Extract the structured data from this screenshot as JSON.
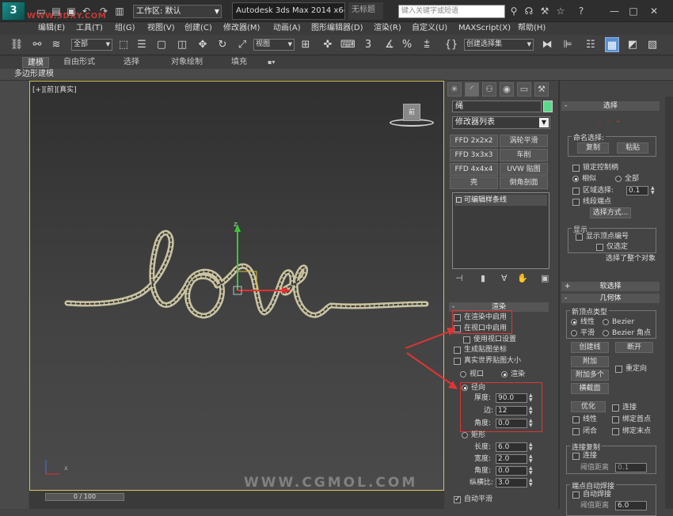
{
  "title_bar": {
    "logo": "3",
    "watermark": "WWW.3DXY.COM",
    "workspace": "工作区: 默认",
    "app_title": "Autodesk 3ds Max  2014 x64",
    "untitled": "无标题",
    "search_placeholder": "键入关键字或短语"
  },
  "menu": [
    "编辑(E)",
    "工具(T)",
    "组(G)",
    "视图(V)",
    "创建(C)",
    "修改器(M)",
    "动画(A)",
    "图形编辑器(D)",
    "渲染(R)",
    "自定义(U)",
    "MAXScript(X)",
    "帮助(H)"
  ],
  "toolbar": {
    "filter": "全部",
    "coord": "视图",
    "selset": "创建选择集",
    "snap": "3",
    "angle": "%"
  },
  "ribbon": {
    "tabs": [
      "建模",
      "自由形式",
      "选择",
      "对象绘制",
      "填充"
    ],
    "active_tab": "建模",
    "subtitle": "多边形建模"
  },
  "viewport": {
    "label": "[+][前][真实]",
    "viewcube": "前",
    "watermark": "WWW.CGMOL.COM",
    "timeline": "0 / 100",
    "gizmo_x": "x",
    "gizmo_z": "z"
  },
  "command_panel": {
    "object_name": "绳",
    "object_color": "#5cd88a",
    "modifier_list": "修改器列表",
    "buttons": [
      "FFD 2x2x2",
      "涡轮平滑",
      "FFD 3x3x3",
      "车削",
      "FFD 4x4x4",
      "UVW 贴图",
      "壳",
      "倒角剖面"
    ],
    "stack_item": "可编辑样条线",
    "rendering": {
      "header": "渲染",
      "enable_render": "在渲染中启用",
      "enable_viewport": "在视口中启用",
      "use_viewport_settings": "使用视口设置",
      "gen_mapping": "生成贴图坐标",
      "real_world": "真实世界贴图大小",
      "viewport": "视口",
      "renderer": "渲染",
      "radial": "径向",
      "thickness_label": "厚度:",
      "thickness": "90.0",
      "sides_label": "边:",
      "sides": "12",
      "angle_label": "角度:",
      "angle": "0.0",
      "rectangular": "矩形",
      "length_label": "长度:",
      "length": "6.0",
      "width_label": "宽度:",
      "width": "2.0",
      "angle2_label": "角度:",
      "angle2": "0.0",
      "aspect_label": "纵横比:",
      "aspect": "3.0",
      "auto_smooth": "自动平滑"
    }
  },
  "right_panel": {
    "selection_header": "选择",
    "named_selection": "命名选择:",
    "copy": "复制",
    "paste": "粘贴",
    "lock_handles": "锁定控制柄",
    "similar": "相似",
    "all": "全部",
    "area_select": "区域选择:",
    "area_value": "0.1",
    "segment_end": "线段端点",
    "select_by": "选择方式...",
    "display": "显示",
    "show_vertex_numbers": "显示顶点编号",
    "selected_only": "仅选定",
    "selected_info": "选择了整个对象",
    "soft_selection": "软选择",
    "geometry": "几何体",
    "new_vertex_type": "新顶点类型",
    "linear": "线性",
    "bezier": "Bezier",
    "smooth": "平滑",
    "bezier_corner": "Bezier 角点",
    "create_line": "创建线",
    "break": "断开",
    "attach": "附加",
    "attach_multiple": "附加多个",
    "reorient": "重定向",
    "cross_section": "横截面",
    "optimize": "优化",
    "connect": "连接",
    "linear2": "线性",
    "bind_first": "绑定首点",
    "closed": "闭合",
    "bind_last": "绑定末点",
    "connect_copy": "连接复制",
    "connect2": "连接",
    "threshold": "阈值距离",
    "threshold_value": "0.1",
    "end_auto_weld": "端点自动焊接",
    "auto_weld": "自动焊接",
    "weld_threshold": "阈值距离",
    "weld_value": "6.0"
  }
}
